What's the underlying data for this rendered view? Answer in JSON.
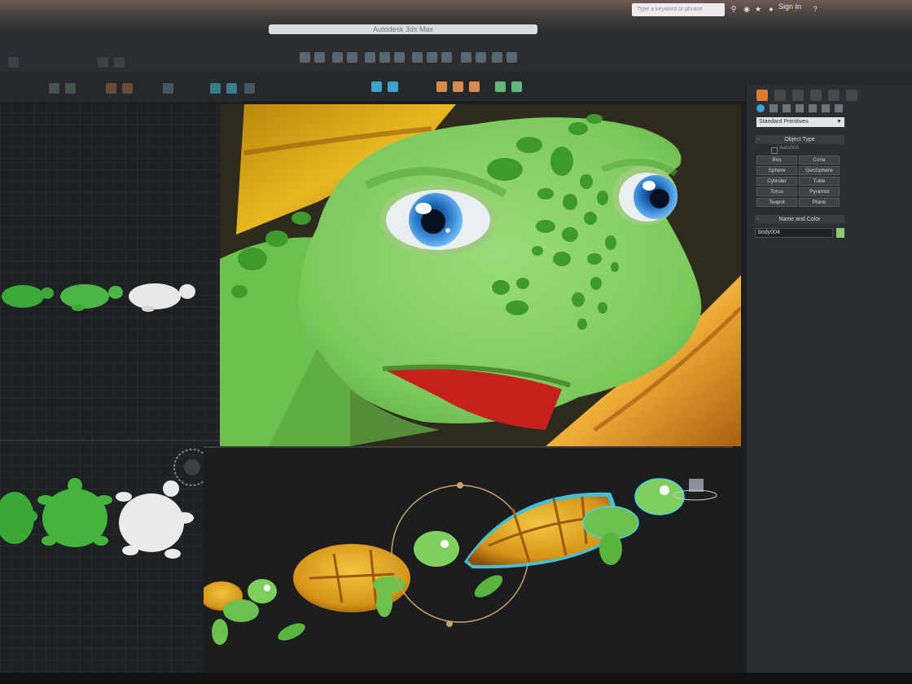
{
  "window": {
    "doc_title": "Autodesk 3ds Max",
    "search_placeholder": "Type a keyword or phrase",
    "signin_label": "Sign In"
  },
  "command_panel": {
    "dropdown_value": "Standard Primitives",
    "object_type_header": "Object Type",
    "autogrid_label": "AutoGrid",
    "primitives": [
      "Box",
      "Cone",
      "Sphere",
      "GeoSphere",
      "Cylinder",
      "Tube",
      "Torus",
      "Pyramid",
      "Teapot",
      "Plane"
    ],
    "name_and_color_header": "Name and Color",
    "object_name": "body004",
    "object_color": "#8ec977"
  },
  "icons": [
    "search-icon",
    "star-icon",
    "user-icon",
    "help-icon",
    "create-tab-icon",
    "modify-tab-icon",
    "hierarchy-tab-icon",
    "motion-tab-icon",
    "display-tab-icon",
    "utilities-tab-icon"
  ],
  "colors": {
    "turtle_skin": "#7fce5e",
    "turtle_spots": "#3f9a2c",
    "shell": "#e2a21c",
    "eye": "#2f8fe0",
    "mouth": "#c8201c",
    "selection_outline": "#49d3e8"
  }
}
